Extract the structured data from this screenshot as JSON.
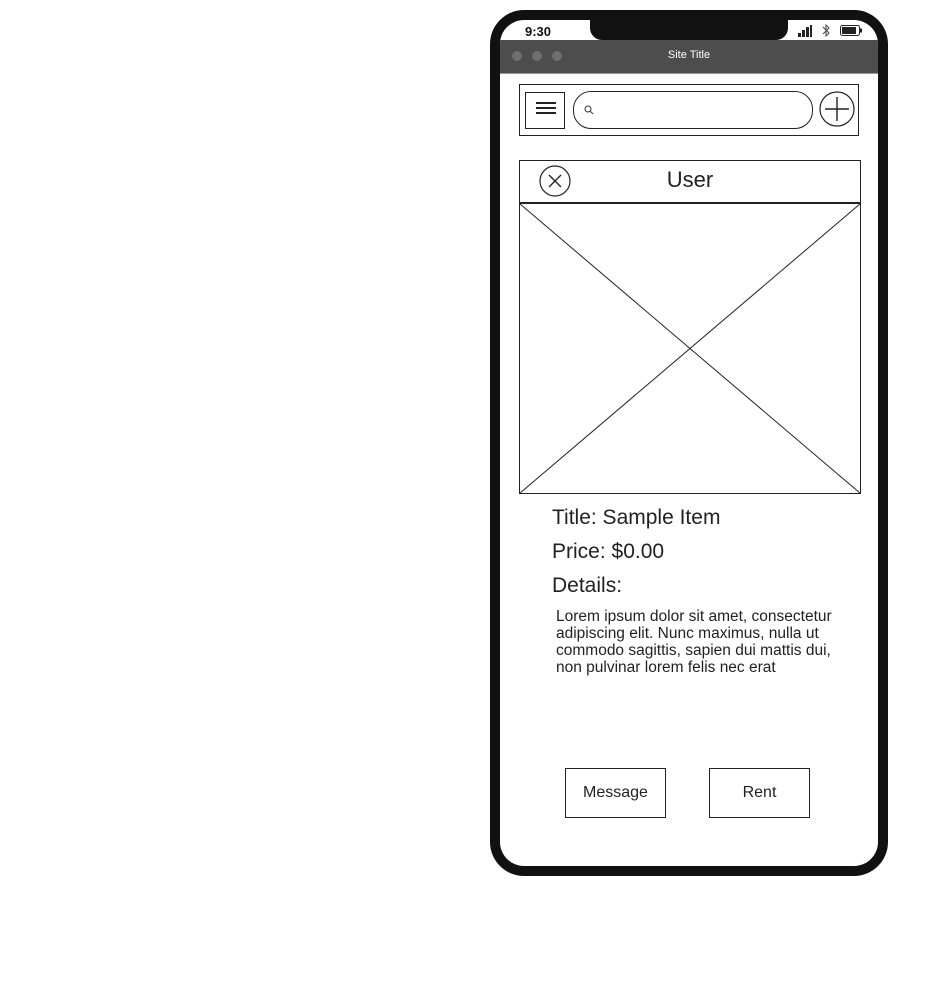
{
  "status_bar": {
    "time": "9:30"
  },
  "window": {
    "site_title": "Site Title"
  },
  "toolbar": {
    "search_placeholder": ""
  },
  "header": {
    "title": "User"
  },
  "item": {
    "title": "Title: Sample Item",
    "price": "Price: $0.00",
    "details_label": "Details:",
    "details_text": "Lorem ipsum dolor sit amet, consectetur adipiscing elit. Nunc maximus, nulla ut commodo sagittis, sapien dui mattis dui, non pulvinar lorem felis nec erat"
  },
  "actions": {
    "message_label": "Message",
    "rent_label": "Rent"
  },
  "icons": [
    "signal-icon",
    "bluetooth-icon",
    "battery-icon",
    "menu-icon",
    "search-icon",
    "plus-icon",
    "close-icon",
    "image-placeholder-icon"
  ]
}
